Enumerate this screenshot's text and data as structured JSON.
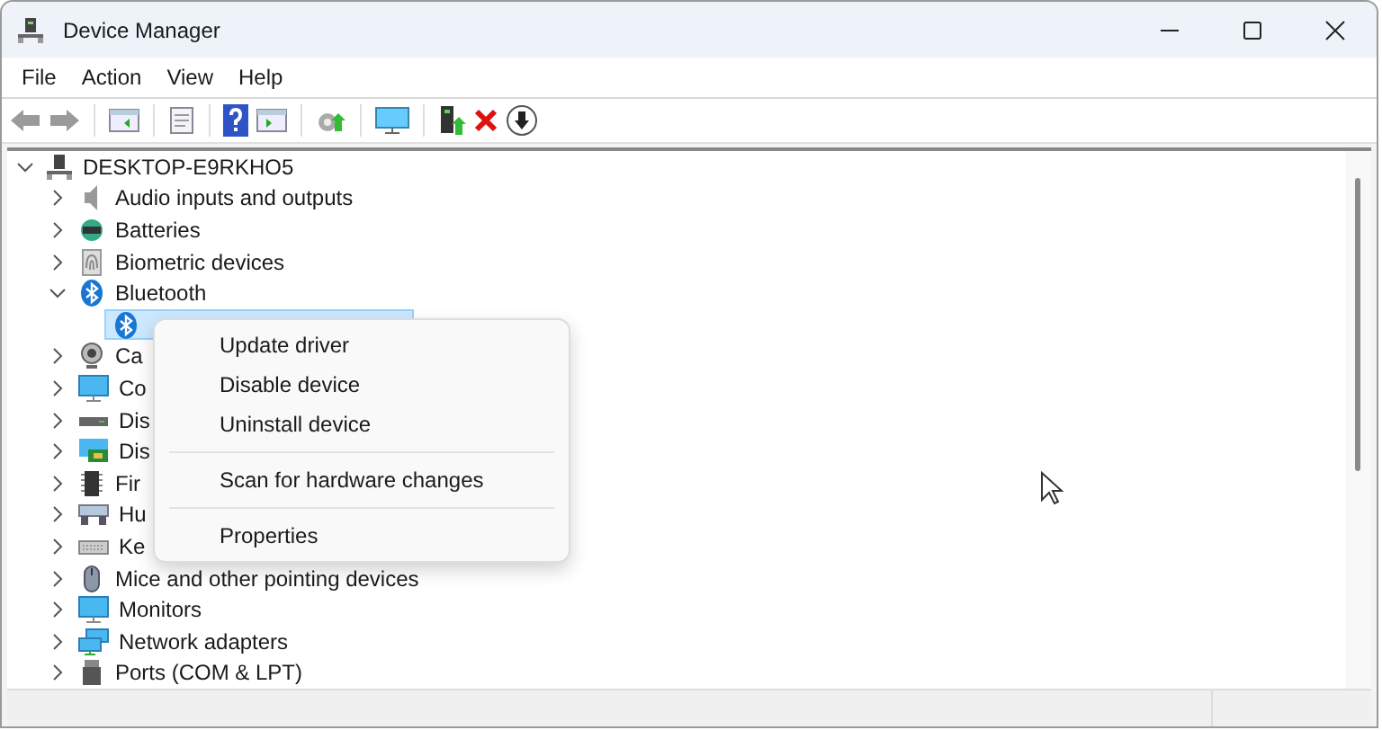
{
  "window": {
    "title": "Device Manager"
  },
  "menu_bar": [
    "File",
    "Action",
    "View",
    "Help"
  ],
  "tree": {
    "label": "DESKTOP-E9RKHO5",
    "expanded": true,
    "children": [
      {
        "label": "Audio inputs and outputs",
        "expanded": false
      },
      {
        "label": "Batteries",
        "expanded": false
      },
      {
        "label": "Biometric devices",
        "expanded": false
      },
      {
        "label": "Bluetooth",
        "expanded": true,
        "children": [
          {
            "selected": true
          }
        ]
      },
      {
        "label": "Ca",
        "expanded": false
      },
      {
        "label": "Co",
        "expanded": false
      },
      {
        "label": "Dis",
        "expanded": false
      },
      {
        "label": "Dis",
        "expanded": false
      },
      {
        "label": "Fir",
        "expanded": false
      },
      {
        "label": "Hu",
        "expanded": false
      },
      {
        "label": "Ke",
        "expanded": false
      },
      {
        "label": "Mice and other pointing devices",
        "expanded": false
      },
      {
        "label": "Monitors",
        "expanded": false
      },
      {
        "label": "Network adapters",
        "expanded": false
      },
      {
        "label": "Ports (COM & LPT)",
        "expanded": false
      }
    ]
  },
  "context_menu": [
    {
      "kind": "item",
      "label": "Update driver"
    },
    {
      "kind": "item",
      "label": "Disable device"
    },
    {
      "kind": "item",
      "label": "Uninstall device"
    },
    {
      "kind": "separator"
    },
    {
      "kind": "item",
      "label": "Scan for hardware changes"
    },
    {
      "kind": "separator"
    },
    {
      "kind": "item",
      "label": "Properties"
    }
  ]
}
